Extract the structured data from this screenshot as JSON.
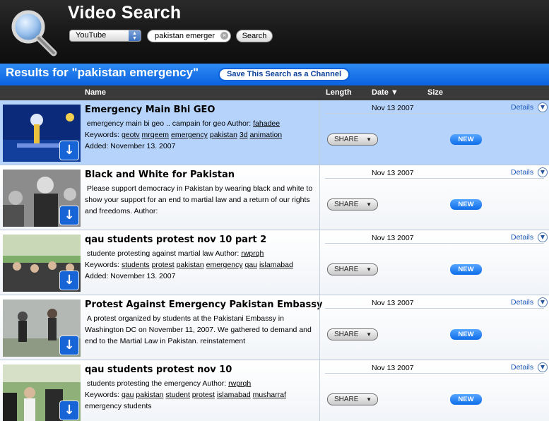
{
  "header": {
    "title": "Video Search",
    "source": "YouTube",
    "query": "pakistan emerger",
    "search_label": "Search"
  },
  "results_bar": {
    "title": "Results for \"pakistan emergency\"",
    "save_label": "Save This Search as a Channel"
  },
  "columns": {
    "name": "Name",
    "length": "Length",
    "date": "Date ▼",
    "size": "Size"
  },
  "results": [
    {
      "title": "Emergency Main Bhi GEO",
      "line1": "emergency main bi geo .. campain for geo Author: ",
      "author": "fahadee",
      "kw_label": "Keywords: ",
      "keywords": [
        "geotv",
        "mrqeem",
        "emergency",
        "pakistan",
        "3d",
        "animation"
      ],
      "added": "Added: November 13. 2007",
      "date": "Nov 13 2007",
      "details": "Details",
      "share": "SHARE",
      "badge": "NEW"
    },
    {
      "title": "Black and White for Pakistan",
      "desc": "Please support democracy in Pakistan by wearing black and white to show your support for an end to martial law and a return of our rights and freedoms. Author:",
      "date": "Nov 13 2007",
      "details": "Details",
      "share": "SHARE",
      "badge": "NEW"
    },
    {
      "title": "qau students protest nov 10 part 2",
      "line1": "studente protesting against martial law Author: ",
      "author": "rwprqh",
      "kw_label": "Keywords: ",
      "keywords": [
        "students",
        "protest",
        "pakistan",
        "emergency",
        "qau",
        "islamabad"
      ],
      "added": "Added: November 13. 2007",
      "date": "Nov 13 2007",
      "details": "Details",
      "share": "SHARE",
      "badge": "NEW"
    },
    {
      "title": "Protest Against Emergency Pakistan Embassy",
      "desc": "A protest organized by students at the Pakistani Embassy in Washington DC on November 11, 2007. We gathered to demand and end to the Martial Law in Pakistan. reinstatement",
      "date": "Nov 13 2007",
      "details": "Details",
      "share": "SHARE",
      "badge": "NEW"
    },
    {
      "title": "qau students protest nov 10",
      "line1": "students protesting the emergency Author: ",
      "author": "rwprqh",
      "kw_label": "Keywords: ",
      "keywords": [
        "qau",
        "pakistan",
        "student",
        "protest",
        "islamabad",
        "musharraf"
      ],
      "kw_extra": "emergency students",
      "date": "Nov 13 2007",
      "details": "Details",
      "share": "SHARE",
      "badge": "NEW"
    }
  ]
}
